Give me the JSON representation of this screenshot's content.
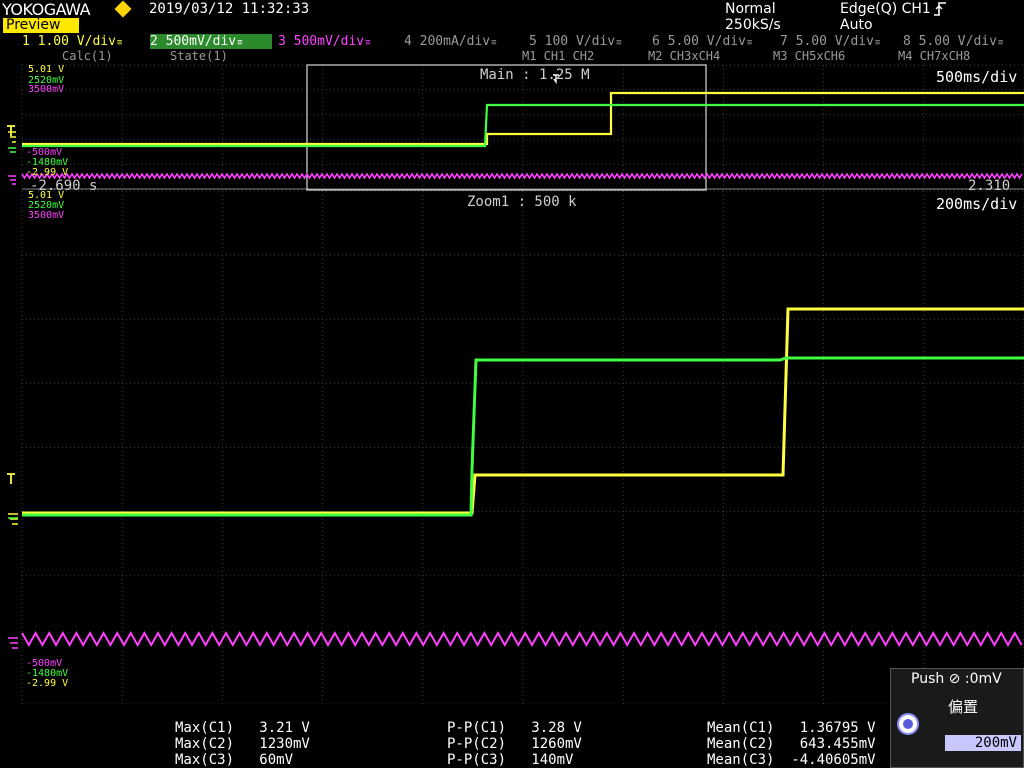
{
  "header": {
    "brand": "YOKOGAWA",
    "preview_label": "Preview",
    "datetime": "2019/03/12 11:32:33",
    "acq_mode": "Normal",
    "sample_rate": "250kS/s",
    "trigger_type": "Edge(Q) CH1",
    "trigger_mode": "Auto"
  },
  "channels": [
    {
      "label": "1  1.00 V/div",
      "tag": "≡",
      "color": "#ffff40"
    },
    {
      "label": "2  500mV/div",
      "tag": "≡",
      "color": "#40ff40"
    },
    {
      "label": "3  500mV/div",
      "tag": "≡",
      "color": "#ff40ff"
    },
    {
      "label": "4  200mA/div",
      "tag": "≡",
      "color": "#9a9a9a"
    },
    {
      "label": "5  100 V/div",
      "tag": "≡",
      "color": "#9a9a9a"
    },
    {
      "label": "6  5.00 V/div",
      "tag": "≡",
      "color": "#9a9a9a"
    },
    {
      "label": "7  5.00 V/div",
      "tag": "≡",
      "color": "#9a9a9a"
    },
    {
      "label": "8  5.00 V/div",
      "tag": "≡",
      "color": "#9a9a9a"
    }
  ],
  "sub_labels": [
    "Calc(1)",
    "State(1)",
    "M1  CH1 CH2",
    "M2  CH3xCH4",
    "M3  CH5xCH6",
    "M4  CH7xCH8"
  ],
  "main_window": {
    "label": "Main : 1.25 M",
    "timebase": "500ms/div",
    "left_time": "-2.690 s",
    "right_time": "2.310"
  },
  "zoom_window": {
    "label": "Zoom1 : 500 k",
    "timebase": "200ms/div"
  },
  "scale_labels": {
    "top_upper": [
      "5.01 V",
      "2520mV",
      "3500mV"
    ],
    "top_lower": [
      "-500mV",
      "-1480mV",
      "-2.99 V"
    ],
    "bottom_upper": [
      "5.01 V",
      "2520mV",
      "3500mV"
    ],
    "bottom_lower": [
      "-500mV",
      "-1480mV",
      "-2.99 V"
    ]
  },
  "measurements": {
    "max": [
      "Max(C1)   3.21 V",
      "Max(C2)   1230mV",
      "Max(C3)   60mV"
    ],
    "pp": [
      "P-P(C1)   3.28 V",
      "P-P(C2)   1260mV",
      "P-P(C3)   140mV"
    ],
    "mean": [
      "Mean(C1)   1.36795 V",
      "Mean(C2)   643.455mV",
      "Mean(C3)  -4.40605mV"
    ]
  },
  "knob_panel": {
    "push_label": "Push ⊘ :0mV",
    "offset_label": "偏置",
    "offset_value": "200mV"
  },
  "colors": {
    "ch1": "#ffff40",
    "ch2": "#40ff40",
    "ch3": "#ff40ff",
    "grid": "#4a4a4a",
    "preview": "#ffe800"
  },
  "icons": {
    "trigger_edge": "rising-edge-icon",
    "knob": "rotary-knob-icon",
    "brand_mark": "diamond-icon"
  }
}
